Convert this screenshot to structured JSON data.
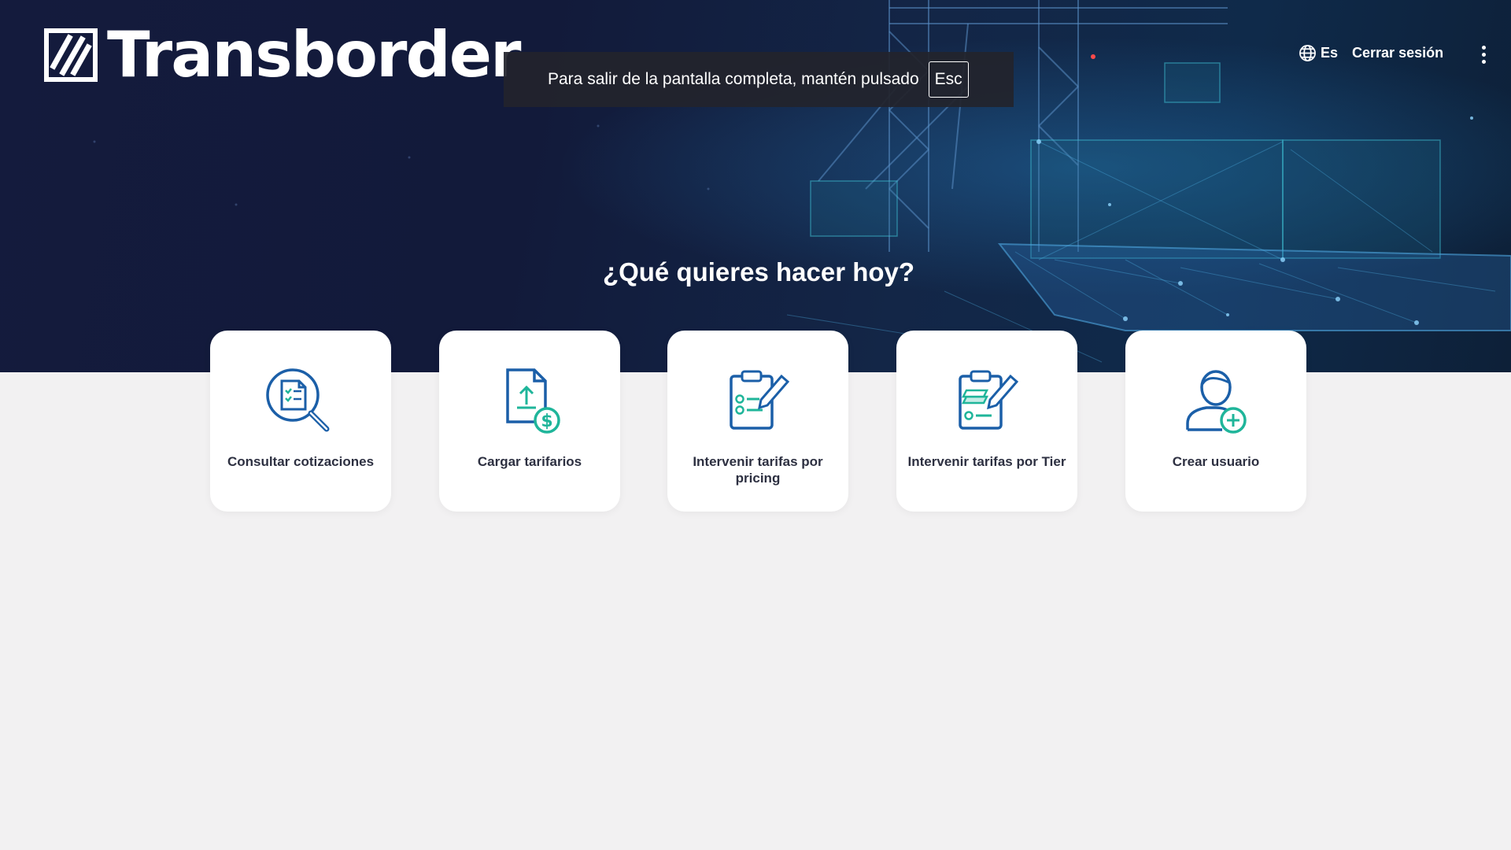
{
  "app": {
    "brand": "Transborder"
  },
  "fullscreen_notice": {
    "text": "Para salir de la pantalla completa, mantén pulsado",
    "key": "Esc"
  },
  "header": {
    "language": "Es",
    "logout": "Cerrar sesión",
    "icons": [
      "globe-icon",
      "more-vertical-icon"
    ]
  },
  "main": {
    "title": "¿Qué quieres hacer hoy?",
    "cards": [
      {
        "label": "Consultar cotizaciones",
        "icon": "search-document-icon"
      },
      {
        "label": "Cargar tarifarios",
        "icon": "upload-tariff-icon"
      },
      {
        "label": "Intervenir tarifas por pricing",
        "icon": "clipboard-edit-icon"
      },
      {
        "label": "Intervenir tarifas por Tier",
        "icon": "clipboard-tier-edit-icon"
      },
      {
        "label": "Crear usuario",
        "icon": "add-user-icon"
      }
    ]
  },
  "colors": {
    "hero_dark": "#141b3d",
    "page_background": "#f2f1f2",
    "icon_primary": "#1b5fa8",
    "icon_accent": "#1fb59a",
    "card_text": "#2d3041"
  }
}
